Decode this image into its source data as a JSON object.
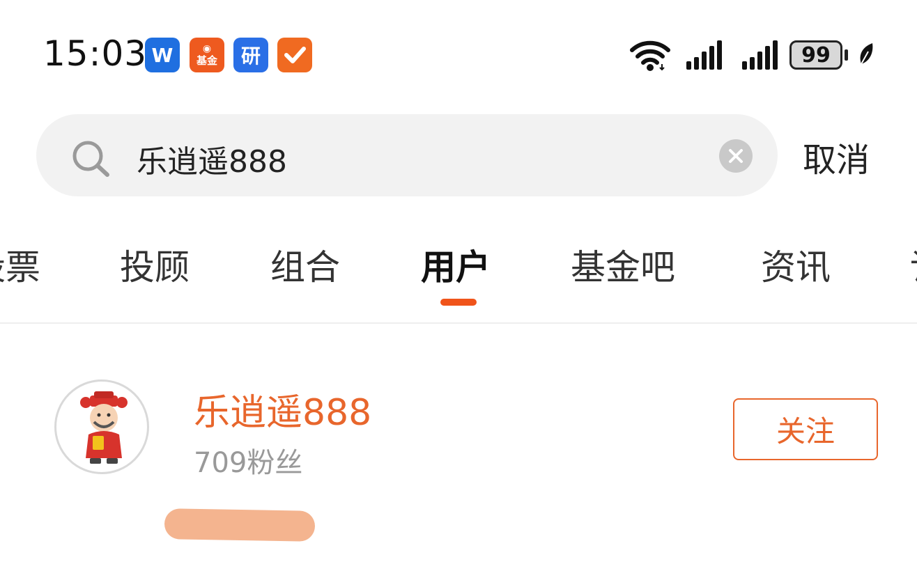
{
  "status_bar": {
    "time": "15:03",
    "apps": [
      {
        "icon": "w-app-icon",
        "text": "W"
      },
      {
        "icon": "fund-app-icon",
        "text": "基金"
      },
      {
        "icon": "research-app-icon",
        "text": "研"
      },
      {
        "icon": "check-app-icon",
        "text": ""
      }
    ],
    "battery": "99"
  },
  "search": {
    "query": "乐逍遥888",
    "cancel_label": "取消"
  },
  "tabs": [
    {
      "label": "股票",
      "active": false
    },
    {
      "label": "投顾",
      "active": false
    },
    {
      "label": "组合",
      "active": false
    },
    {
      "label": "用户",
      "active": true
    },
    {
      "label": "基金吧",
      "active": false
    },
    {
      "label": "资讯",
      "active": false
    },
    {
      "label": "讨",
      "active": false
    }
  ],
  "results": [
    {
      "name": "乐逍遥888",
      "fans": "709粉丝",
      "follow_label": "关注"
    }
  ],
  "colors": {
    "accent": "#f0541a",
    "name": "#e8662c",
    "search_bg": "#f2f2f2"
  }
}
